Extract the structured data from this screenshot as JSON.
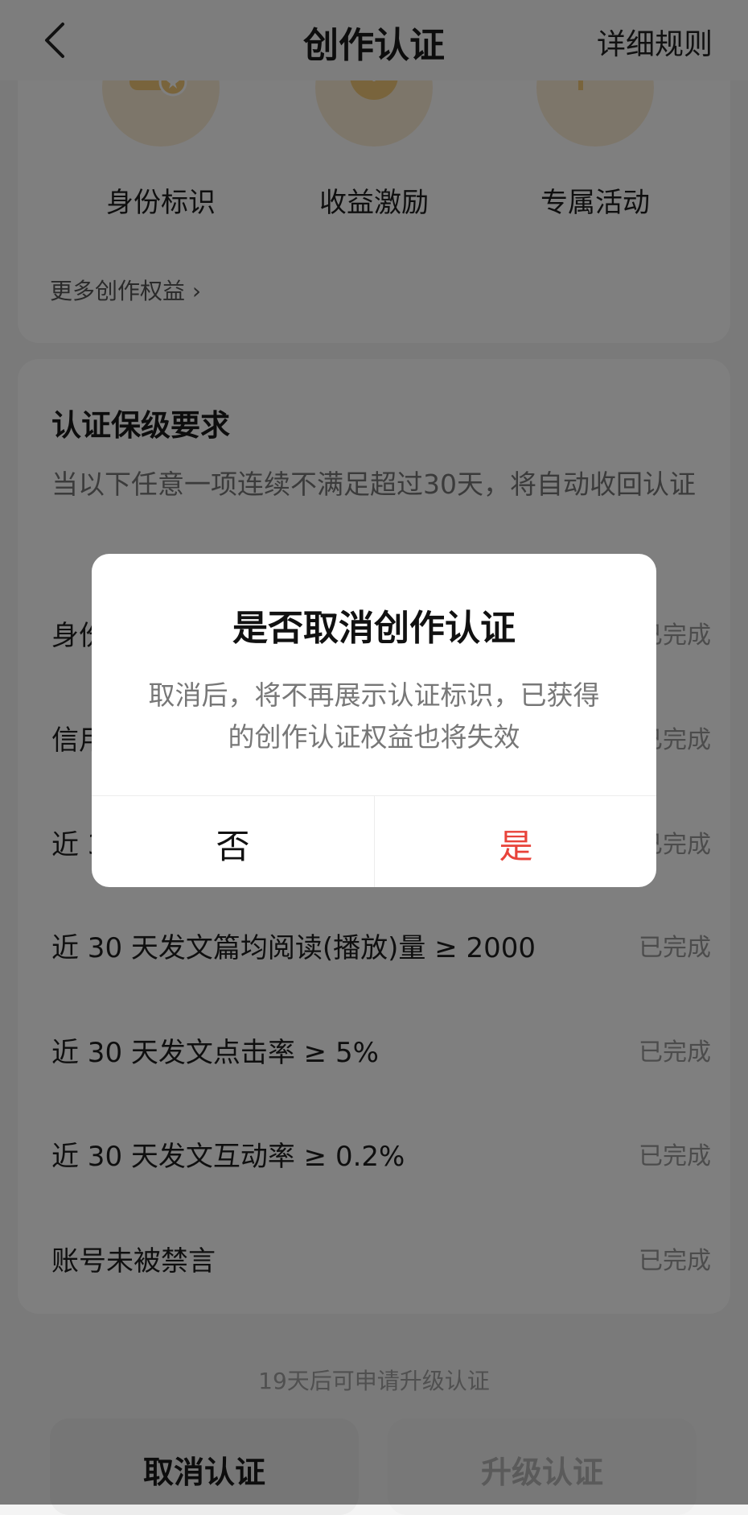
{
  "nav": {
    "back_icon": "chevron-left-icon",
    "title": "创作认证",
    "rules_link": "详细规则"
  },
  "benefits": {
    "items": [
      {
        "label": "身份标识",
        "icon": "identity-badge-icon"
      },
      {
        "label": "收益激励",
        "icon": "revenue-coin-icon"
      },
      {
        "label": "专属活动",
        "icon": "flag-icon"
      }
    ],
    "more_link": "更多创作权益",
    "more_icon": "chevron-right-icon",
    "icon_bg_color": "#fbecd5",
    "icon_color": "#f3c978"
  },
  "requirements": {
    "title": "认证保级要求",
    "description": "当以下任意一项连续不满足超过30天，将自动收回认证",
    "items": [
      {
        "text": "身份",
        "status": "已完成"
      },
      {
        "text": "信用",
        "status": "已完成"
      },
      {
        "text": "近 3",
        "status": "已完成"
      },
      {
        "text": "近 30 天发文篇均阅读(播放)量 ≥ 2000",
        "status": "已完成"
      },
      {
        "text": "近 30 天发文点击率 ≥ 5%",
        "status": "已完成"
      },
      {
        "text": "近 30 天发文互动率 ≥ 0.2%",
        "status": "已完成"
      },
      {
        "text": "账号未被禁言",
        "status": "已完成"
      }
    ]
  },
  "footer": {
    "note": "19天后可申请升级认证",
    "cancel_button": "取消认证",
    "upgrade_button": "升级认证"
  },
  "dialog": {
    "title": "是否取消创作认证",
    "message": "取消后，将不再展示认证标识，已获得的创作认证权益也将失效",
    "no_button": "否",
    "yes_button": "是",
    "yes_color": "#e8433a"
  }
}
